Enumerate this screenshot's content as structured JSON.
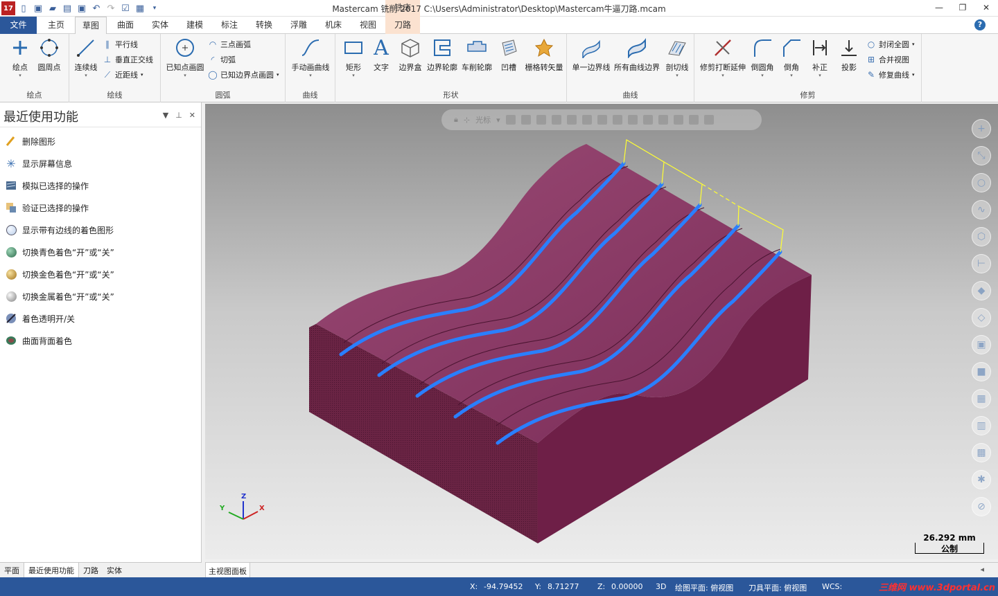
{
  "app": {
    "title": "Mastercam 铣削 2017  C:\\Users\\Administrator\\Desktop\\Mastercam牛逼刀路.mcam",
    "context_tab_header": "铣床",
    "logo_text": "17"
  },
  "tabs": [
    {
      "label": "文件"
    },
    {
      "label": "主页"
    },
    {
      "label": "草图"
    },
    {
      "label": "曲面"
    },
    {
      "label": "实体"
    },
    {
      "label": "建模"
    },
    {
      "label": "标注"
    },
    {
      "label": "转换"
    },
    {
      "label": "浮雕"
    },
    {
      "label": "机床"
    },
    {
      "label": "视图"
    },
    {
      "label": "刀路"
    }
  ],
  "ribbon": {
    "groups": {
      "points": "绘点",
      "lines": "绘线",
      "arcs": "圆弧",
      "curves": "曲线",
      "shapes": "形状",
      "curve2": "曲线",
      "trim": "修剪"
    },
    "points": {
      "btn1": "绘点",
      "btn2": "圆周点"
    },
    "lines": {
      "big": "连续线",
      "s1": "平行线",
      "s2": "垂直正交线",
      "s3": "近距线"
    },
    "arcs": {
      "big": "已知点画圆",
      "s1": "三点画弧",
      "s2": "切弧",
      "s3": "已知边界点画圆"
    },
    "curves": {
      "big": "手动画曲线"
    },
    "shapes": {
      "b1": "矩形",
      "b2": "文字",
      "b3": "边界盒",
      "b4": "边界轮廓",
      "b5": "车削轮廓",
      "b6": "凹槽",
      "b7": "栅格转矢量"
    },
    "curve2": {
      "b1": "单一边界线",
      "b2": "所有曲线边界",
      "b3": "剖切线"
    },
    "trim": {
      "b1": "修剪打断延伸",
      "b2": "倒圆角",
      "b3": "倒角",
      "b4": "补正",
      "b5": "投影",
      "s1": "封闭全圆",
      "s2": "合并视图",
      "s3": "修复曲线"
    }
  },
  "left_panel": {
    "title": "最近使用功能",
    "items": [
      {
        "label": "删除图形",
        "icon": "pencil-icon"
      },
      {
        "label": "显示屏幕信息",
        "icon": "asterisk-icon"
      },
      {
        "label": "模拟已选择的操作",
        "icon": "simulate-icon"
      },
      {
        "label": "验证已选择的操作",
        "icon": "verify-icon"
      },
      {
        "label": "显示带有边线的着色图形",
        "icon": "sphere-edge-icon"
      },
      {
        "label": "切换青色着色“开”或“关”",
        "icon": "sphere-cyan-icon"
      },
      {
        "label": "切换金色着色“开”或“关”",
        "icon": "sphere-gold-icon"
      },
      {
        "label": "切换金属着色“开”或“关”",
        "icon": "sphere-metal-icon"
      },
      {
        "label": "着色透明开/关",
        "icon": "transparent-icon"
      },
      {
        "label": "曲面背面着色",
        "icon": "backface-icon"
      }
    ],
    "bottom_tabs": [
      {
        "label": "平面"
      },
      {
        "label": "最近使用功能"
      },
      {
        "label": "刀路"
      },
      {
        "label": "实体"
      }
    ]
  },
  "viewport": {
    "toolbar_label": "光标",
    "scale_value": "26.292 mm",
    "scale_unit": "公制",
    "axis": {
      "x": "X",
      "y": "Y",
      "z": "Z"
    },
    "tab_label": "主视图面板",
    "colors": {
      "part": "#7a2c58",
      "toolpath": "#2a7fff",
      "boundary": "#ffff33"
    }
  },
  "status": {
    "x_label": "X:",
    "x_value": "-94.79452",
    "y_label": "Y:",
    "y_value": "8.71277",
    "z_label": "Z:",
    "z_value": "0.00000",
    "mode": "3D",
    "cplane": "绘图平面: 俯视图",
    "tplane": "刀具平面: 俯视图",
    "wcs": "WCS:",
    "watermark": "三维网 www.3dportal.cn"
  }
}
